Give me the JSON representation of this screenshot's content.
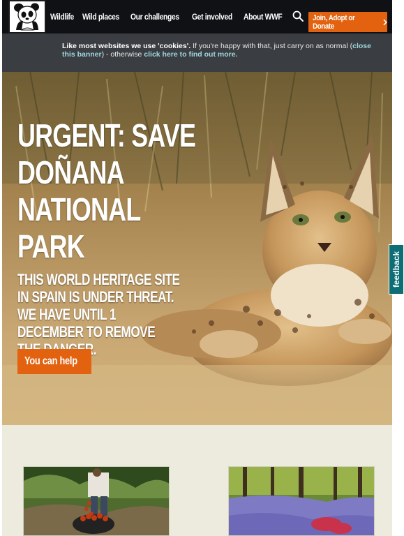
{
  "header": {
    "logo_alt": "WWF",
    "nav": [
      "Wildlife",
      "Wild places",
      "Our challenges",
      "Get involved",
      "About WWF"
    ],
    "donate_label": "Join, Adopt or Donate"
  },
  "cookie_banner": {
    "lead": "Like most websites we use 'cookies'.",
    "text_1": " If you're happy with that, just carry on as normal (",
    "close_link": "close this banner",
    "text_2": ") - otherwise ",
    "more_link": "click here to find out more."
  },
  "hero": {
    "title": "URGENT: SAVE DOÑANA NATIONAL PARK",
    "subtitle": "THIS WORLD HERITAGE SITE IN SPAIN IS UNDER THREAT. WE HAVE UNTIL 1 DECEMBER TO REMOVE THE DANGER.",
    "cta_label": "You can help"
  },
  "feedback": {
    "label": "feedback"
  },
  "colors": {
    "accent": "#e2620f",
    "header": "#0f1115",
    "cookie_bg": "#3a3d41",
    "feedback": "#0d6f75",
    "page_bg": "#ecebdd"
  }
}
